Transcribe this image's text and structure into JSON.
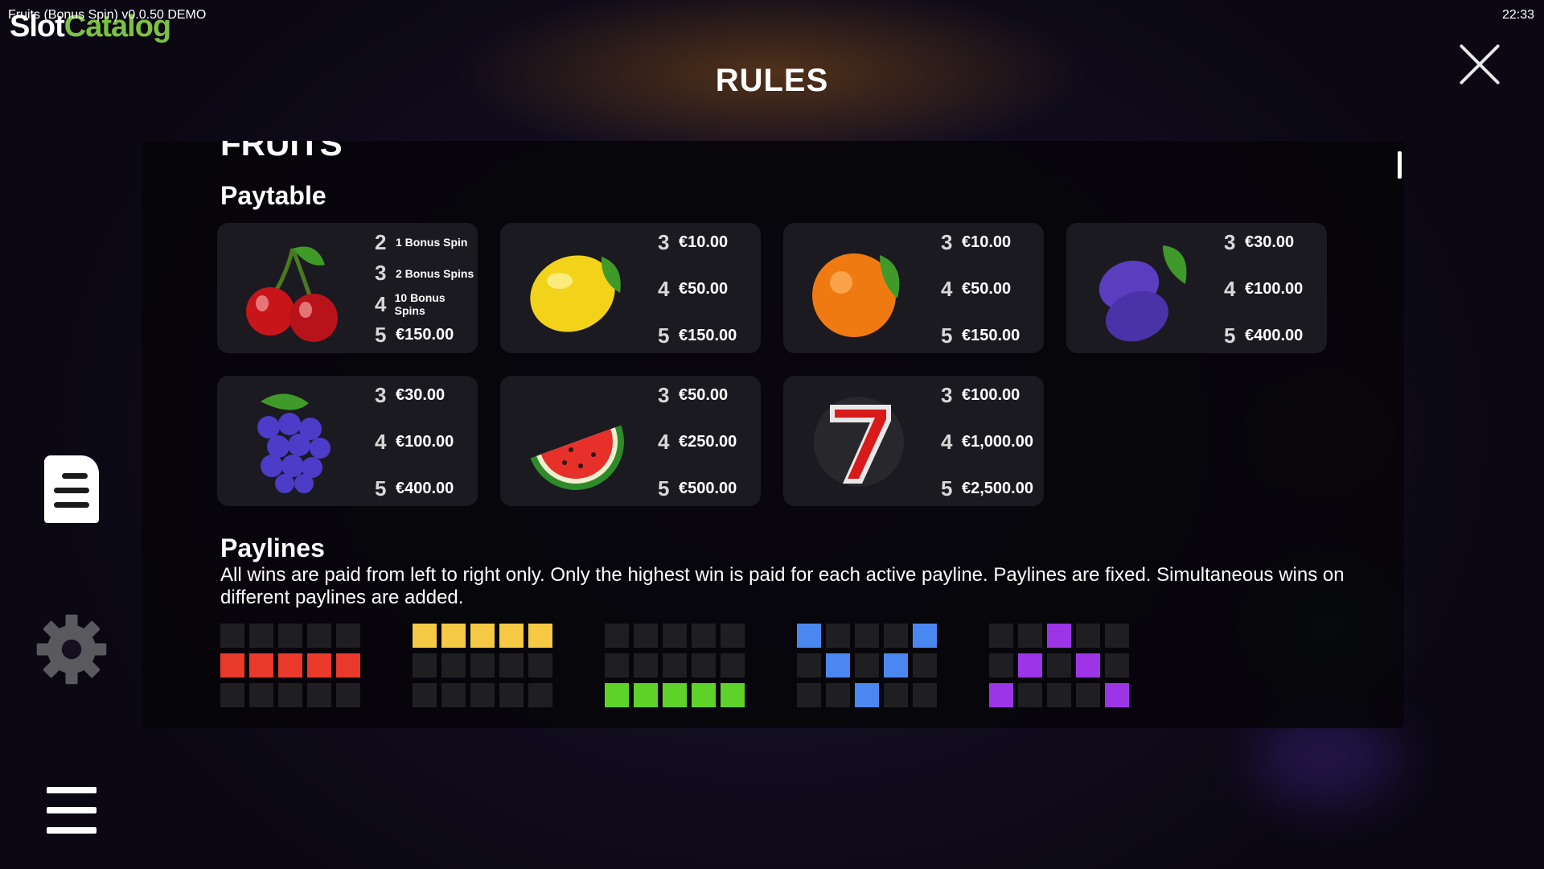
{
  "top": {
    "build_text": "Fruits (Bonus Spin) v0.0.50 DEMO",
    "clock": "22:33",
    "brand_part1": "Slot",
    "brand_part2": "Catalog"
  },
  "dialog": {
    "title": "RULES",
    "cut_heading": "FRUITS",
    "paytable_title": "Paytable",
    "paylines_title": "Paylines",
    "paylines_text": "All wins are paid from left to right only. Only the highest win is paid for each active payline. Paylines are fixed. Simultaneous wins on different paylines are added."
  },
  "paytable": [
    {
      "symbol": "cherry-icon",
      "rows": [
        {
          "count": "2",
          "value": "1 Bonus Spin"
        },
        {
          "count": "3",
          "value": "2 Bonus Spins"
        },
        {
          "count": "4",
          "value": "10 Bonus Spins"
        },
        {
          "count": "5",
          "value": "€150.00"
        }
      ]
    },
    {
      "symbol": "lemon-icon",
      "rows": [
        {
          "count": "3",
          "value": "€10.00"
        },
        {
          "count": "4",
          "value": "€50.00"
        },
        {
          "count": "5",
          "value": "€150.00"
        }
      ]
    },
    {
      "symbol": "orange-icon",
      "rows": [
        {
          "count": "3",
          "value": "€10.00"
        },
        {
          "count": "4",
          "value": "€50.00"
        },
        {
          "count": "5",
          "value": "€150.00"
        }
      ]
    },
    {
      "symbol": "plum-icon",
      "rows": [
        {
          "count": "3",
          "value": "€30.00"
        },
        {
          "count": "4",
          "value": "€100.00"
        },
        {
          "count": "5",
          "value": "€400.00"
        }
      ]
    },
    {
      "symbol": "grapes-icon",
      "rows": [
        {
          "count": "3",
          "value": "€30.00"
        },
        {
          "count": "4",
          "value": "€100.00"
        },
        {
          "count": "5",
          "value": "€400.00"
        }
      ]
    },
    {
      "symbol": "watermelon-icon",
      "rows": [
        {
          "count": "3",
          "value": "€50.00"
        },
        {
          "count": "4",
          "value": "€250.00"
        },
        {
          "count": "5",
          "value": "€500.00"
        }
      ]
    },
    {
      "symbol": "seven-icon",
      "rows": [
        {
          "count": "3",
          "value": "€100.00"
        },
        {
          "count": "4",
          "value": "€1,000.00"
        },
        {
          "count": "5",
          "value": "€2,500.00"
        }
      ]
    }
  ],
  "paylines": [
    {
      "color": "#e8392a",
      "rows": [
        1,
        1,
        1,
        1,
        1
      ]
    },
    {
      "color": "#f6c944",
      "rows": [
        0,
        0,
        0,
        0,
        0
      ]
    },
    {
      "color": "#5fd22a",
      "rows": [
        2,
        2,
        2,
        2,
        2
      ]
    },
    {
      "color": "#4a87f0",
      "rows": [
        0,
        1,
        2,
        1,
        0
      ]
    },
    {
      "color": "#9c35e6",
      "rows": [
        2,
        1,
        0,
        1,
        2
      ]
    }
  ],
  "sidebar": {
    "rules_icon": "rules-icon",
    "settings_icon": "gear-icon",
    "menu_icon": "menu-icon"
  }
}
